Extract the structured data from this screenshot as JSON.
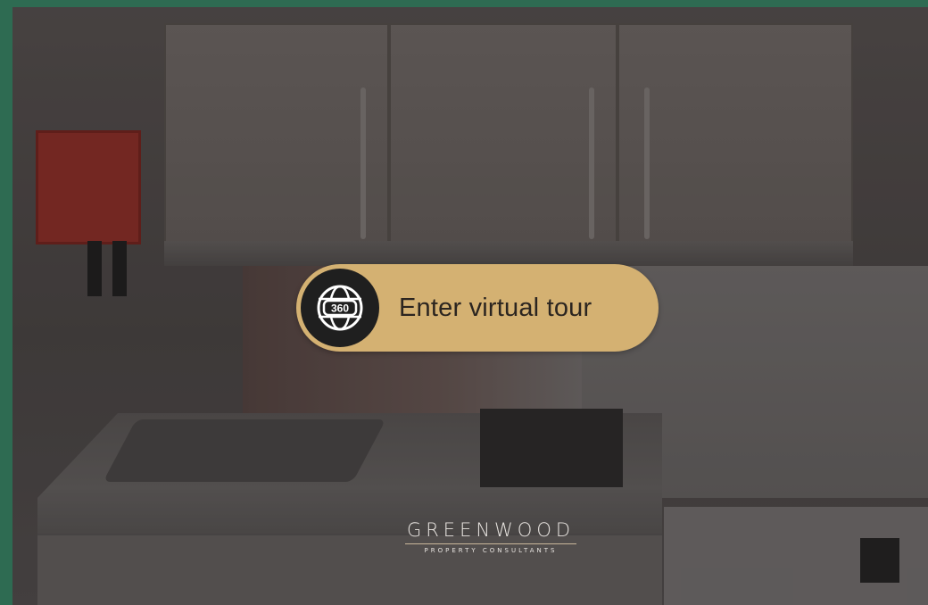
{
  "tour": {
    "button_label": "Enter virtual tour",
    "icon": "360-globe-icon",
    "icon_text": "360",
    "accent_color": "#d4b172"
  },
  "brand": {
    "name": "GREENWOOD",
    "tagline": "PROPERTY CONSULTANTS"
  },
  "colors": {
    "frame_border": "#2e6b52",
    "fire_blanket": "#9a2f27"
  }
}
